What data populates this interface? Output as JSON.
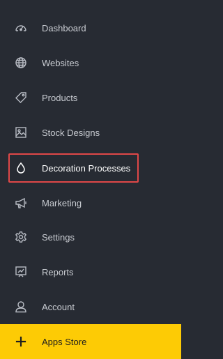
{
  "sidebar": {
    "items": [
      {
        "label": "Dashboard",
        "icon": "dashboard-gauge-icon"
      },
      {
        "label": "Websites",
        "icon": "globe-icon"
      },
      {
        "label": "Products",
        "icon": "tag-icon"
      },
      {
        "label": "Stock Designs",
        "icon": "image-icon"
      },
      {
        "label": "Decoration Processes",
        "icon": "droplet-icon",
        "active": true
      },
      {
        "label": "Marketing",
        "icon": "megaphone-icon"
      },
      {
        "label": "Settings",
        "icon": "gear-icon"
      },
      {
        "label": "Reports",
        "icon": "chart-board-icon"
      },
      {
        "label": "Account",
        "icon": "user-icon"
      }
    ],
    "apps_store": {
      "label": "Apps Store",
      "icon": "plus-icon"
    }
  },
  "colors": {
    "background": "#272b33",
    "text": "#c9ccd2",
    "active_text": "#ffffff",
    "icon": "#b8bcc4",
    "highlight_border": "#e04848",
    "apps_store_bg": "#fdcb05"
  }
}
